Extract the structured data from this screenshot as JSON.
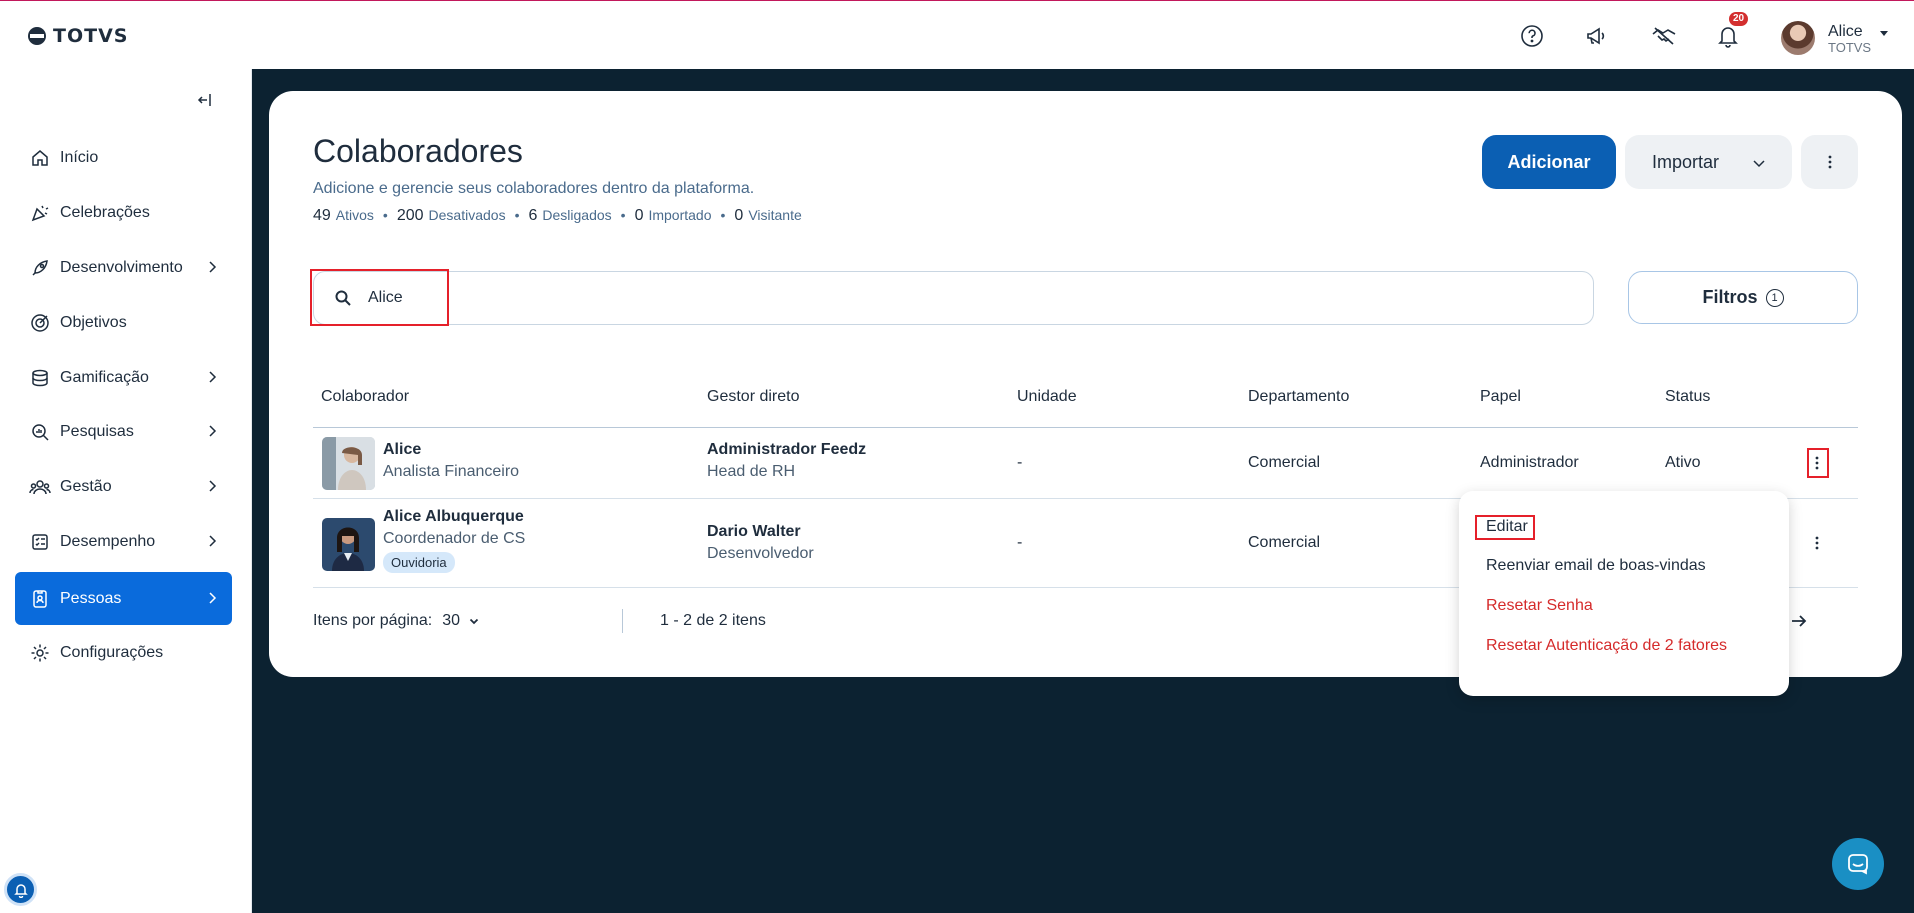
{
  "header": {
    "logo_text": "TOTVS",
    "notification_count": "20",
    "user_name": "Alice",
    "user_org": "TOTVS",
    "icons": [
      "help-icon",
      "megaphone-icon",
      "handshake-icon",
      "bell-icon"
    ]
  },
  "sidebar": {
    "items": [
      {
        "label": "Início",
        "icon": "home-icon"
      },
      {
        "label": "Celebrações",
        "icon": "party-icon"
      },
      {
        "label": "Desenvolvimento",
        "icon": "rocket-icon"
      },
      {
        "label": "Objetivos",
        "icon": "target-icon"
      },
      {
        "label": "Gamificação",
        "icon": "coins-icon"
      },
      {
        "label": "Pesquisas",
        "icon": "search-chart-icon"
      },
      {
        "label": "Gestão",
        "icon": "people-icon"
      },
      {
        "label": "Desempenho",
        "icon": "checklist-icon"
      },
      {
        "label": "Pessoas",
        "icon": "badge-icon"
      },
      {
        "label": "Configurações",
        "icon": "gear-icon"
      }
    ],
    "active": "Pessoas"
  },
  "page": {
    "title": "Colaboradores",
    "subtitle": "Adicione e gerencie seus colaboradores dentro da plataforma.",
    "stats": [
      {
        "count": "49",
        "label": "Ativos"
      },
      {
        "count": "200",
        "label": "Desativados"
      },
      {
        "count": "6",
        "label": "Desligados"
      },
      {
        "count": "0",
        "label": "Importado"
      },
      {
        "count": "0",
        "label": "Visitante"
      }
    ],
    "add_label": "Adicionar",
    "import_label": "Importar",
    "filters_label": "Filtros",
    "filters_count": "1"
  },
  "search": {
    "value": "Alice"
  },
  "table": {
    "headers": {
      "colaborador": "Colaborador",
      "gestor": "Gestor direto",
      "unidade": "Unidade",
      "departamento": "Departamento",
      "papel": "Papel",
      "status": "Status"
    },
    "rows": [
      {
        "name": "Alice",
        "role": "Analista Financeiro",
        "manager": "Administrador Feedz",
        "manager_role": "Head de RH",
        "unit": "-",
        "department": "Comercial",
        "papel": "Administrador",
        "status": "Ativo",
        "tag": ""
      },
      {
        "name": "Alice Albuquerque",
        "role": "Coordenador de CS",
        "manager": "Dario Walter",
        "manager_role": "Desenvolvedor",
        "unit": "-",
        "department": "Comercial",
        "papel": "",
        "status": "",
        "tag": "Ouvidoria"
      }
    ]
  },
  "pagination": {
    "per_page_label": "Itens por página:",
    "per_page_value": "30",
    "range": "1 - 2 de 2 itens"
  },
  "row_menu": {
    "items": [
      {
        "label": "Editar",
        "danger": false
      },
      {
        "label": "Reenviar email de boas-vindas",
        "danger": false
      },
      {
        "label": "Resetar Senha",
        "danger": true
      },
      {
        "label": "Resetar Autenticação de 2 fatores",
        "danger": true
      }
    ]
  },
  "colors": {
    "primary": "#0b5fb3",
    "active_nav": "#0a6bdc",
    "dark_bg": "#0c2231",
    "danger": "#d52b2b",
    "highlight": "#e5202a"
  }
}
